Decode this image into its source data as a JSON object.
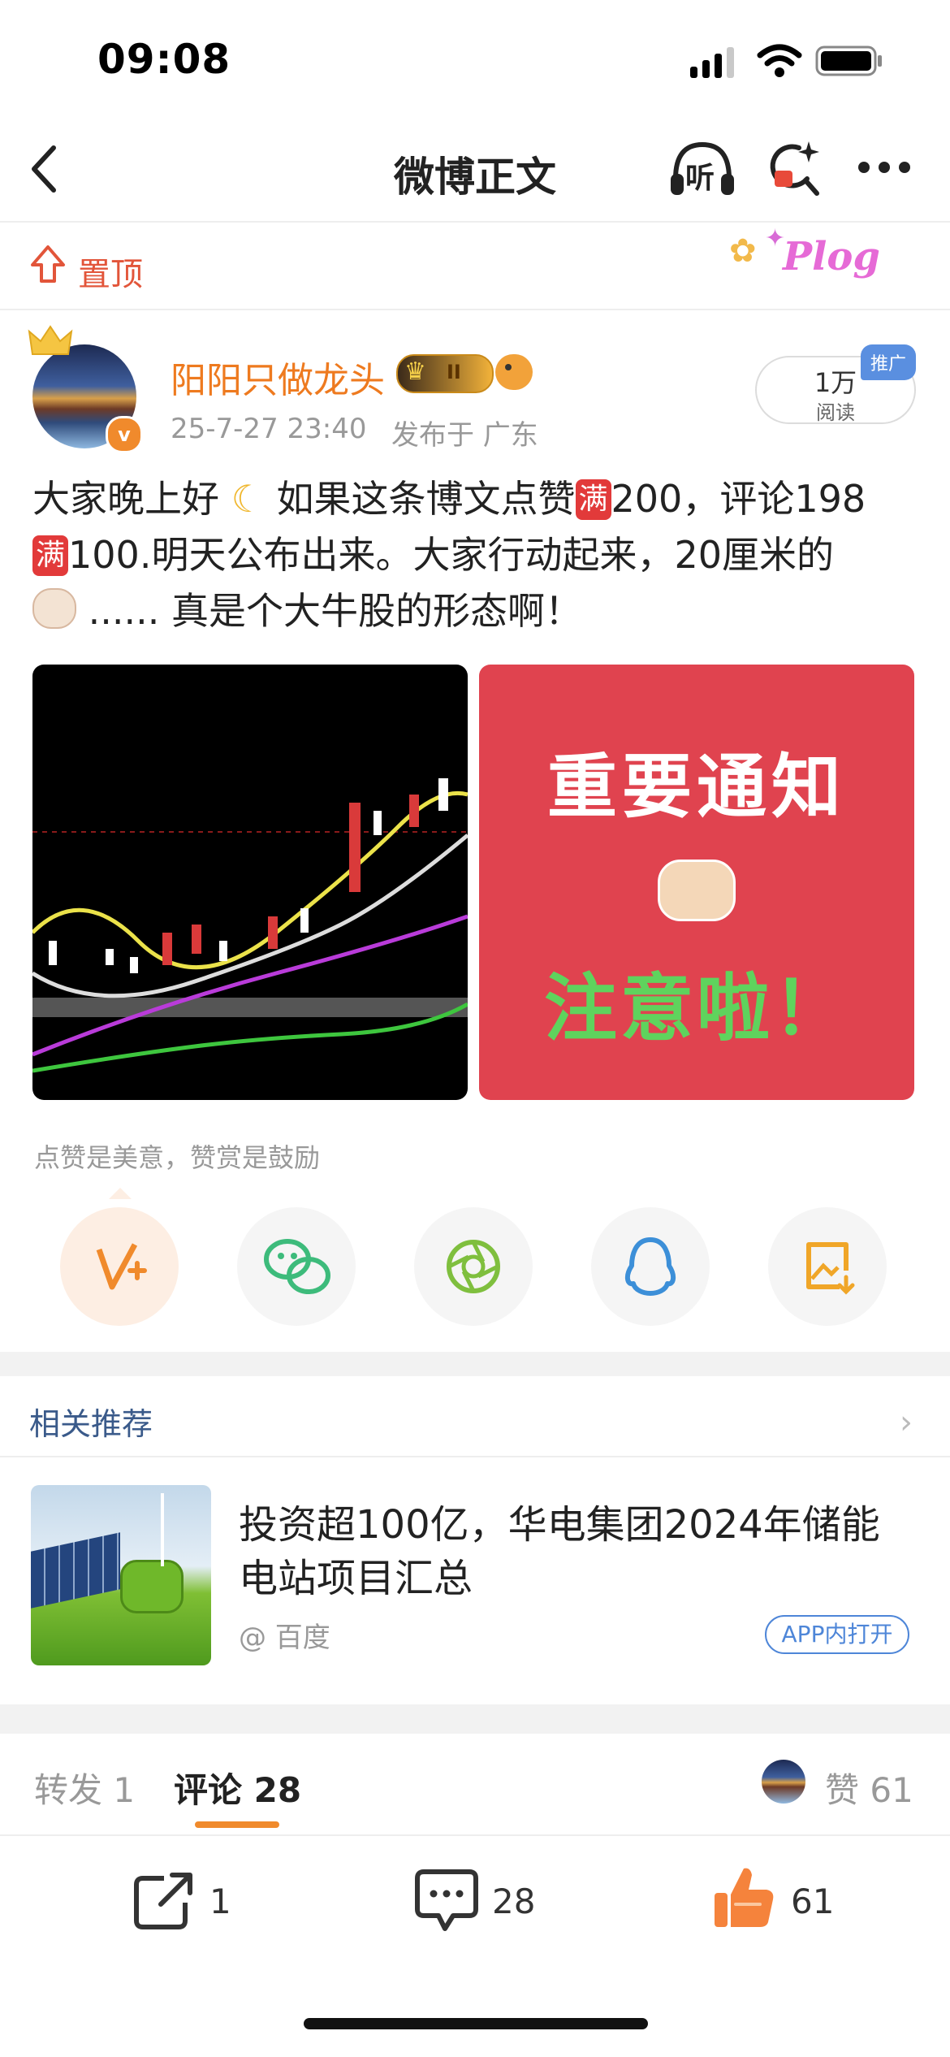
{
  "status_bar": {
    "time": "09:08"
  },
  "nav": {
    "title": "微博正文",
    "listen_label": "听"
  },
  "pin": {
    "label": "置顶",
    "sticker_text": "Plog"
  },
  "post": {
    "author": "阳阳只做龙头",
    "level_badge": "II",
    "timestamp": "25-7-27 23:40",
    "published_from": "发布于 广东",
    "reads": {
      "count": "1万",
      "label": "阅读"
    },
    "promo_tag": "推广",
    "text": {
      "part1": "大家晚上好",
      "part2": "如果这条博文点赞",
      "mark": "满",
      "part3": "200，评论198",
      "part4": "100.明天公布出来。大家行动起来，20厘米的",
      "part5": "...... 真是个大牛股的形态啊！"
    },
    "image2": {
      "title": "重要通知",
      "subtitle": "注意啦！"
    },
    "caption": "点赞是美意，赞赏是鼓励"
  },
  "share_buttons": [
    {
      "icon": "reward-v-plus-icon"
    },
    {
      "icon": "wechat-icon"
    },
    {
      "icon": "moments-icon"
    },
    {
      "icon": "qq-icon"
    },
    {
      "icon": "save-image-icon"
    }
  ],
  "related": {
    "section_title": "相关推荐",
    "headline": "投资超100亿，华电集团2024年储能电站项目汇总",
    "source": "@ 百度",
    "open_in_app": "APP内打开"
  },
  "tabs": {
    "repost": "转发 1",
    "comments": "评论 28",
    "likes": "赞 61"
  },
  "bottom_bar": {
    "repost_count": "1",
    "comment_count": "28",
    "like_count": "61"
  },
  "colors": {
    "accent_orange": "#ee7a1f",
    "pin_red": "#e2553a",
    "link_blue": "#4e86d8",
    "notice_red": "#e0434f"
  }
}
